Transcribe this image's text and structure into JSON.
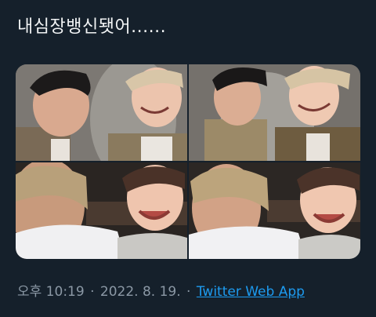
{
  "tweet": {
    "text": "내심장뱅신됏어......"
  },
  "media": {
    "photos": [
      {
        "label": "photo 1",
        "alt": ""
      },
      {
        "label": "photo 2",
        "alt": ""
      },
      {
        "label": "photo 3",
        "alt": ""
      },
      {
        "label": "photo 4",
        "alt": ""
      }
    ]
  },
  "meta": {
    "time": "오후 10:19",
    "separator": "·",
    "date": "2022. 8. 19.",
    "source": "Twitter Web App"
  },
  "colors": {
    "background": "#15202b",
    "text": "#f7f9f9",
    "secondary": "#8b98a5",
    "link": "#1d9bf0"
  }
}
